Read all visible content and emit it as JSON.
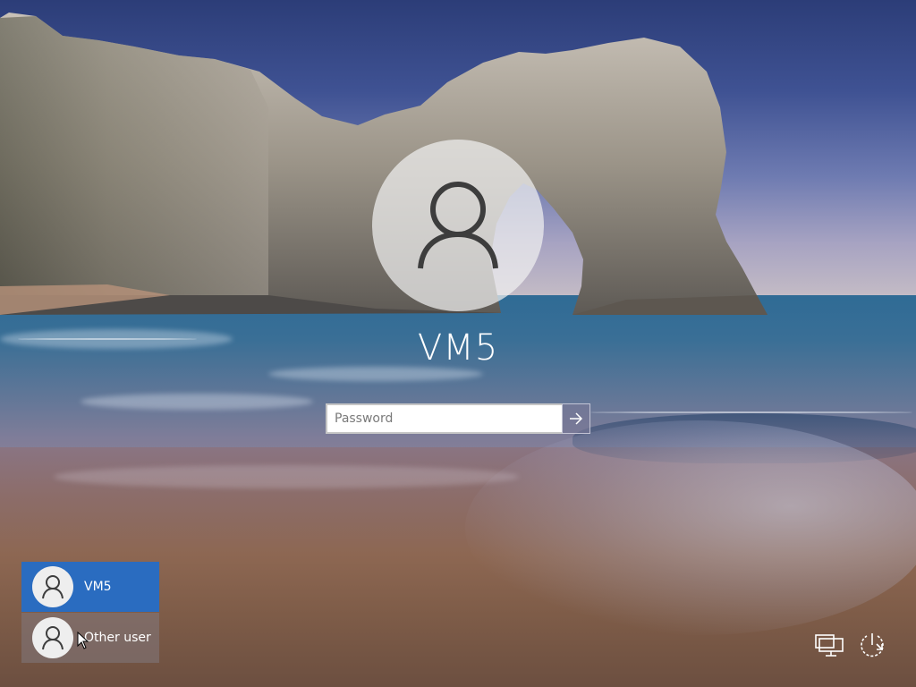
{
  "login": {
    "username": "VM5",
    "password_placeholder": "Password",
    "submit_icon": "arrow-right-icon"
  },
  "user_list": [
    {
      "label": "VM5",
      "icon": "user-icon",
      "selected": true
    },
    {
      "label": "Other user",
      "icon": "user-icon",
      "selected": false
    }
  ],
  "corner_icons": {
    "network": "network-icon",
    "power": "power-icon"
  },
  "colors": {
    "selected_tile": "#2a6cc0",
    "avatar_bg": "#eeeeee",
    "text": "#ffffff"
  }
}
